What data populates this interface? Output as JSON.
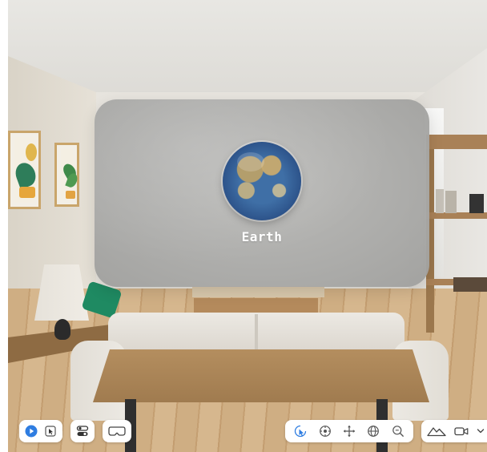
{
  "panel": {
    "title": "Earth"
  },
  "toolbar": {
    "left": [
      {
        "icon": "play-icon",
        "active": true
      },
      {
        "icon": "cursor-select-icon",
        "active": false
      },
      {
        "icon": "controls-toggle-icon",
        "active": false
      },
      {
        "icon": "headset-icon",
        "active": false
      }
    ],
    "center": [
      {
        "icon": "interact-pointer-icon",
        "active": true
      },
      {
        "icon": "orbit-icon",
        "active": false
      },
      {
        "icon": "move-pan-icon",
        "active": false
      },
      {
        "icon": "globe-rotate-icon",
        "active": false
      },
      {
        "icon": "zoom-icon",
        "active": false
      }
    ],
    "right": [
      {
        "icon": "environment-mountain-icon"
      },
      {
        "icon": "camera-icon"
      },
      {
        "icon": "chevron-down-icon"
      }
    ]
  },
  "colors": {
    "accent": "#2f7de1",
    "icon": "#555555",
    "panel": "#aeaeac",
    "label": "#ffffff"
  }
}
